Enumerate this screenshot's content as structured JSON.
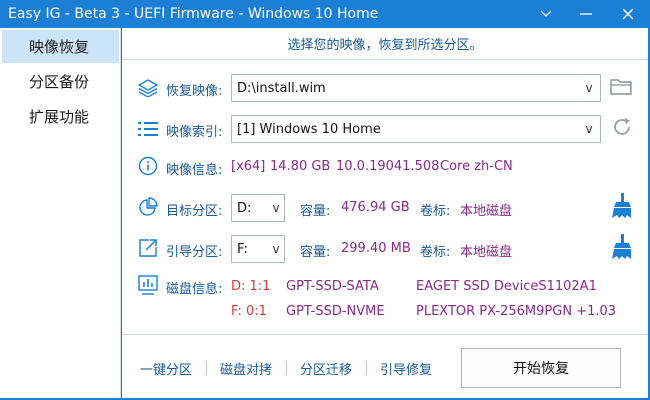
{
  "window": {
    "title": "Easy IG - Beta 3 - UEFI Firmware - Windows 10 Home",
    "accent_color": "#1b7fd6",
    "controls": [
      "chevron-down-icon",
      "minimize-icon",
      "close-icon"
    ]
  },
  "sidebar": {
    "items": [
      {
        "label": "映像恢复",
        "active": true
      },
      {
        "label": "分区备份",
        "active": false
      },
      {
        "label": "扩展功能",
        "active": false
      }
    ]
  },
  "main": {
    "banner": "选择您的映像，恢复到所选分区。",
    "image_restore": {
      "label": "恢复映像:",
      "value": "D:\\install.wim",
      "dropdown_glyph": "v",
      "browse_icon": "folder-icon"
    },
    "image_index": {
      "label": "映像索引:",
      "value": "[1] Windows 10 Home",
      "dropdown_glyph": "v",
      "refresh_icon": "refresh-icon"
    },
    "image_info": {
      "label": "映像信息:",
      "arch": "[x64]",
      "size": "14.80 GB",
      "version": "10.0.19041.508",
      "edition": "Core zh-CN"
    },
    "target_partition": {
      "label": "目标分区:",
      "value": "D:",
      "dropdown_glyph": "v",
      "capacity_label": "容量:",
      "capacity": "476.94 GB",
      "volume_label": "卷标:",
      "volume": "本地磁盘",
      "clean_icon": "broom-icon"
    },
    "boot_partition": {
      "label": "引导分区:",
      "value": "F:",
      "dropdown_glyph": "v",
      "capacity_label": "容量:",
      "capacity": "299.40 MB",
      "volume_label": "卷标:",
      "volume": "本地磁盘",
      "clean_icon": "broom-icon"
    },
    "disk_info": {
      "label": "磁盘信息:",
      "disks": [
        {
          "id": "D: 1:1",
          "type": "GPT-SSD-SATA",
          "model": "EAGET SSD DeviceS1102A1"
        },
        {
          "id": "F: 0:1",
          "type": "GPT-SSD-NVME",
          "model": "PLEXTOR PX-256M9PGN +1.03"
        }
      ]
    }
  },
  "footer": {
    "links": [
      "一键分区",
      "磁盘对拷",
      "分区迁移",
      "引导修复"
    ],
    "start_button": "开始恢复"
  }
}
